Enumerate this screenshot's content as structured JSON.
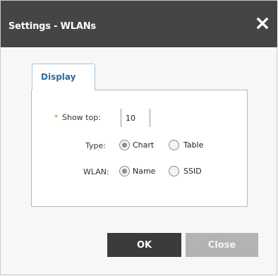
{
  "dialog": {
    "title": "Settings - WLANs",
    "close_icon": "close-icon"
  },
  "tabs": [
    {
      "label": "Display",
      "active": true
    }
  ],
  "form": {
    "show_top": {
      "required_mark": "*",
      "label": "Show top:",
      "value": "10"
    },
    "type": {
      "label": "Type:",
      "options": [
        {
          "label": "Chart",
          "selected": true
        },
        {
          "label": "Table",
          "selected": false
        }
      ]
    },
    "wlan": {
      "label": "WLAN:",
      "options": [
        {
          "label": "Name",
          "selected": true
        },
        {
          "label": "SSID",
          "selected": false
        }
      ]
    }
  },
  "buttons": {
    "ok_label": "OK",
    "close_label": "Close"
  },
  "colors": {
    "titlebar": "#454545",
    "tab_text": "#2f6a9b",
    "required": "#e07a10",
    "ok_button": "#3b3b3b",
    "close_button": "#b3b3b3"
  }
}
